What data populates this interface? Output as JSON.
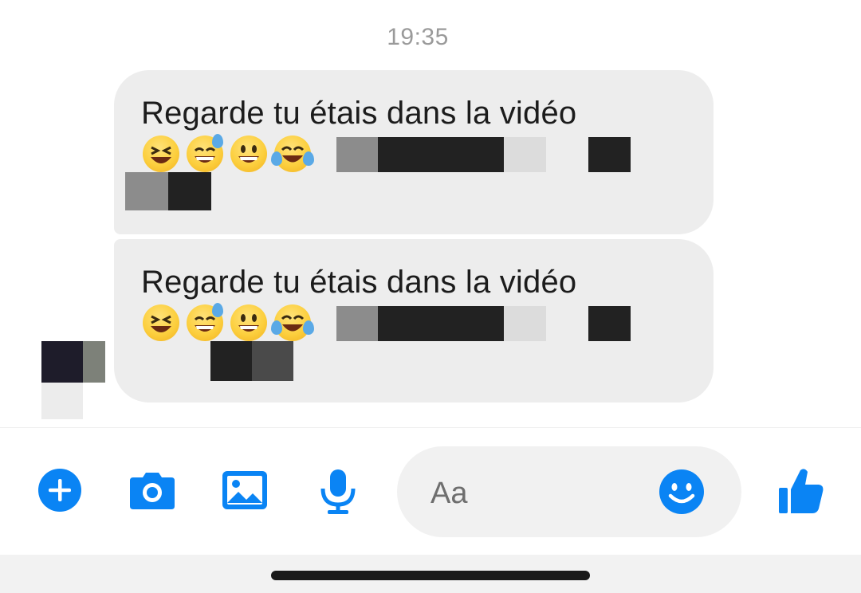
{
  "timestamp": "19:35",
  "messages": [
    {
      "text": "Regarde tu étais dans la vidéo",
      "emojis": [
        "laughing-squint-emoji",
        "grinning-sweat-emoji",
        "grinning-emoji",
        "tears-of-joy-emoji"
      ]
    },
    {
      "text": "Regarde tu étais dans la vidéo",
      "emojis": [
        "laughing-squint-emoji",
        "grinning-sweat-emoji",
        "grinning-emoji",
        "tears-of-joy-emoji"
      ]
    }
  ],
  "composer": {
    "placeholder": "Aa",
    "icons": [
      "plus-icon",
      "camera-icon",
      "image-icon",
      "microphone-icon",
      "emoji-icon",
      "thumbs-up-icon"
    ],
    "accent_color": "#0a84f4"
  }
}
